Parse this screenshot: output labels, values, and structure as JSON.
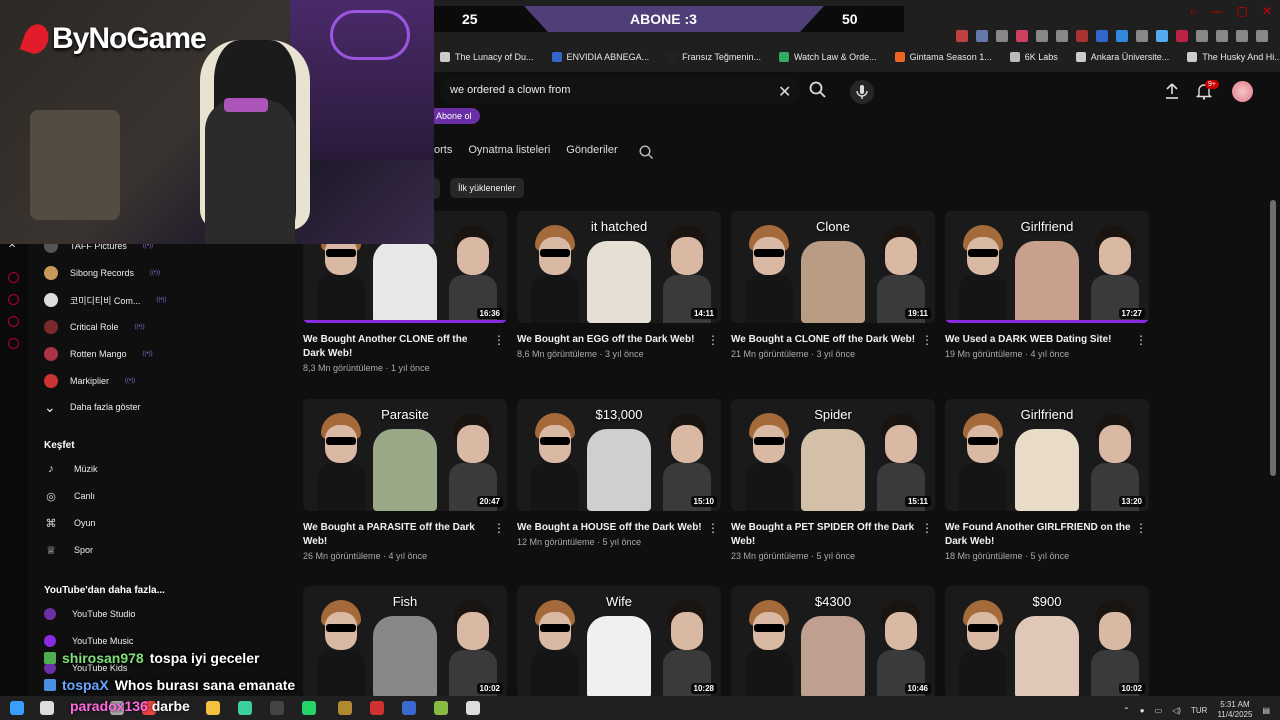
{
  "stream_bar": {
    "left": "25",
    "middle": "ABONE :3",
    "right": "50"
  },
  "logo": "ByNoGame",
  "bookmarks": [
    "The Lunacy of Du...",
    "ENVIDIA ABNEGA...",
    "Fransız Teğmenin...",
    "Watch Law & Orde...",
    "Gintama Season 1...",
    "6K Labs",
    "Ankara Üniversite...",
    "The Husky And Hi..."
  ],
  "search": {
    "value": "we ordered a clown from"
  },
  "notifications": {
    "badge": "9+"
  },
  "channel": {
    "subscribe_label": "Abone ol",
    "tabs": [
      "orts",
      "Oynatma listeleri",
      "Gönderiler"
    ],
    "filter_chip": "İlk yüklenenler"
  },
  "sidebar": {
    "subscriptions": [
      {
        "label": "TAFF Pictures",
        "color": "#555555"
      },
      {
        "label": "Sibong Records",
        "color": "#c89a5a"
      },
      {
        "label": "코미디티비 Com...",
        "color": "#dddddd"
      },
      {
        "label": "Critical Role",
        "color": "#7a2a2a"
      },
      {
        "label": "Rotten Mango",
        "color": "#aa3344"
      },
      {
        "label": "Markiplier",
        "color": "#cc3333"
      }
    ],
    "show_more": "Daha fazla göster",
    "explore_heading": "Keşfet",
    "explore": [
      {
        "label": "Müzik",
        "icon": "music-note-icon",
        "glyph": "♪"
      },
      {
        "label": "Canlı",
        "icon": "live-icon",
        "glyph": "◎"
      },
      {
        "label": "Oyun",
        "icon": "gamepad-icon",
        "glyph": "⌘"
      },
      {
        "label": "Spor",
        "icon": "trophy-icon",
        "glyph": "♕"
      }
    ],
    "more_heading": "YouTube'dan daha fazla...",
    "more": [
      {
        "label": "YouTube Studio"
      },
      {
        "label": "YouTube Music"
      },
      {
        "label": "YouTube Kids"
      }
    ]
  },
  "videos": [
    {
      "title": "We Bought Another CLONE off the Dark Web!",
      "views": "8,3 Mn görüntüleme",
      "age": "1 yıl önce",
      "duration": "16:36",
      "thumb_text": "",
      "prop_color": "#e8e8e8",
      "progress": 1.0
    },
    {
      "title": "We Bought an EGG off the Dark Web!",
      "views": "8,6 Mn görüntüleme",
      "age": "3 yıl önce",
      "duration": "14:11",
      "thumb_text": "it hatched",
      "prop_color": "#e6e0d4",
      "progress": 0
    },
    {
      "title": "We Bought a CLONE off the Dark Web!",
      "views": "21 Mn görüntüleme",
      "age": "3 yıl önce",
      "duration": "19:11",
      "thumb_text": "Clone",
      "prop_color": "#b89c84",
      "progress": 0
    },
    {
      "title": "We Used a DARK WEB Dating Site!",
      "views": "19 Mn görüntüleme",
      "age": "4 yıl önce",
      "duration": "17:27",
      "thumb_text": "Girlfriend",
      "prop_color": "#c8a08c",
      "progress": 1.0
    },
    {
      "title": "We Bought a PARASITE off the Dark Web!",
      "views": "26 Mn görüntüleme",
      "age": "4 yıl önce",
      "duration": "20:47",
      "thumb_text": "Parasite",
      "prop_color": "#9aa888",
      "progress": 0
    },
    {
      "title": "We Bought a HOUSE off the Dark Web!",
      "views": "12 Mn görüntüleme",
      "age": "5 yıl önce",
      "duration": "15:10",
      "thumb_text": "$13,000",
      "prop_color": "#cfcfcf",
      "progress": 0
    },
    {
      "title": "We Bought a PET SPIDER Off the Dark Web!",
      "views": "23 Mn görüntüleme",
      "age": "5 yıl önce",
      "duration": "15:11",
      "thumb_text": "Spider",
      "prop_color": "#d4c0a8",
      "progress": 0
    },
    {
      "title": "We Found Another GIRLFRIEND on the Dark Web!",
      "views": "18 Mn görüntüleme",
      "age": "5 yıl önce",
      "duration": "13:20",
      "thumb_text": "Girlfriend",
      "prop_color": "#e8dcc8",
      "progress": 0
    },
    {
      "title": "",
      "views": "",
      "age": "",
      "duration": "10:02",
      "thumb_text": "Fish",
      "prop_color": "#888888",
      "progress": 0
    },
    {
      "title": "",
      "views": "",
      "age": "",
      "duration": "10:28",
      "thumb_text": "Wife",
      "prop_color": "#f0f0f0",
      "progress": 0
    },
    {
      "title": "",
      "views": "",
      "age": "",
      "duration": "10:46",
      "thumb_text": "$4300",
      "prop_color": "#bfa090",
      "progress": 0
    },
    {
      "title": "",
      "views": "",
      "age": "",
      "duration": "10:02",
      "thumb_text": "$900",
      "prop_color": "#e0c8b8",
      "progress": 0
    }
  ],
  "chat": [
    {
      "user": "shirosan978",
      "message": "tospa iyi geceler"
    },
    {
      "user": "tospaX",
      "message": "Whos burası sana emanate"
    }
  ],
  "taskbar_overlay": {
    "user": "paradox136",
    "message": "darbe"
  },
  "tray": {
    "language": "TUR",
    "time": "5:31 AM",
    "date": "11/4/2025"
  },
  "colors": {
    "accent": "#8a2be2",
    "youtube_red": "#cc0000",
    "background": "#0f0f0f"
  }
}
